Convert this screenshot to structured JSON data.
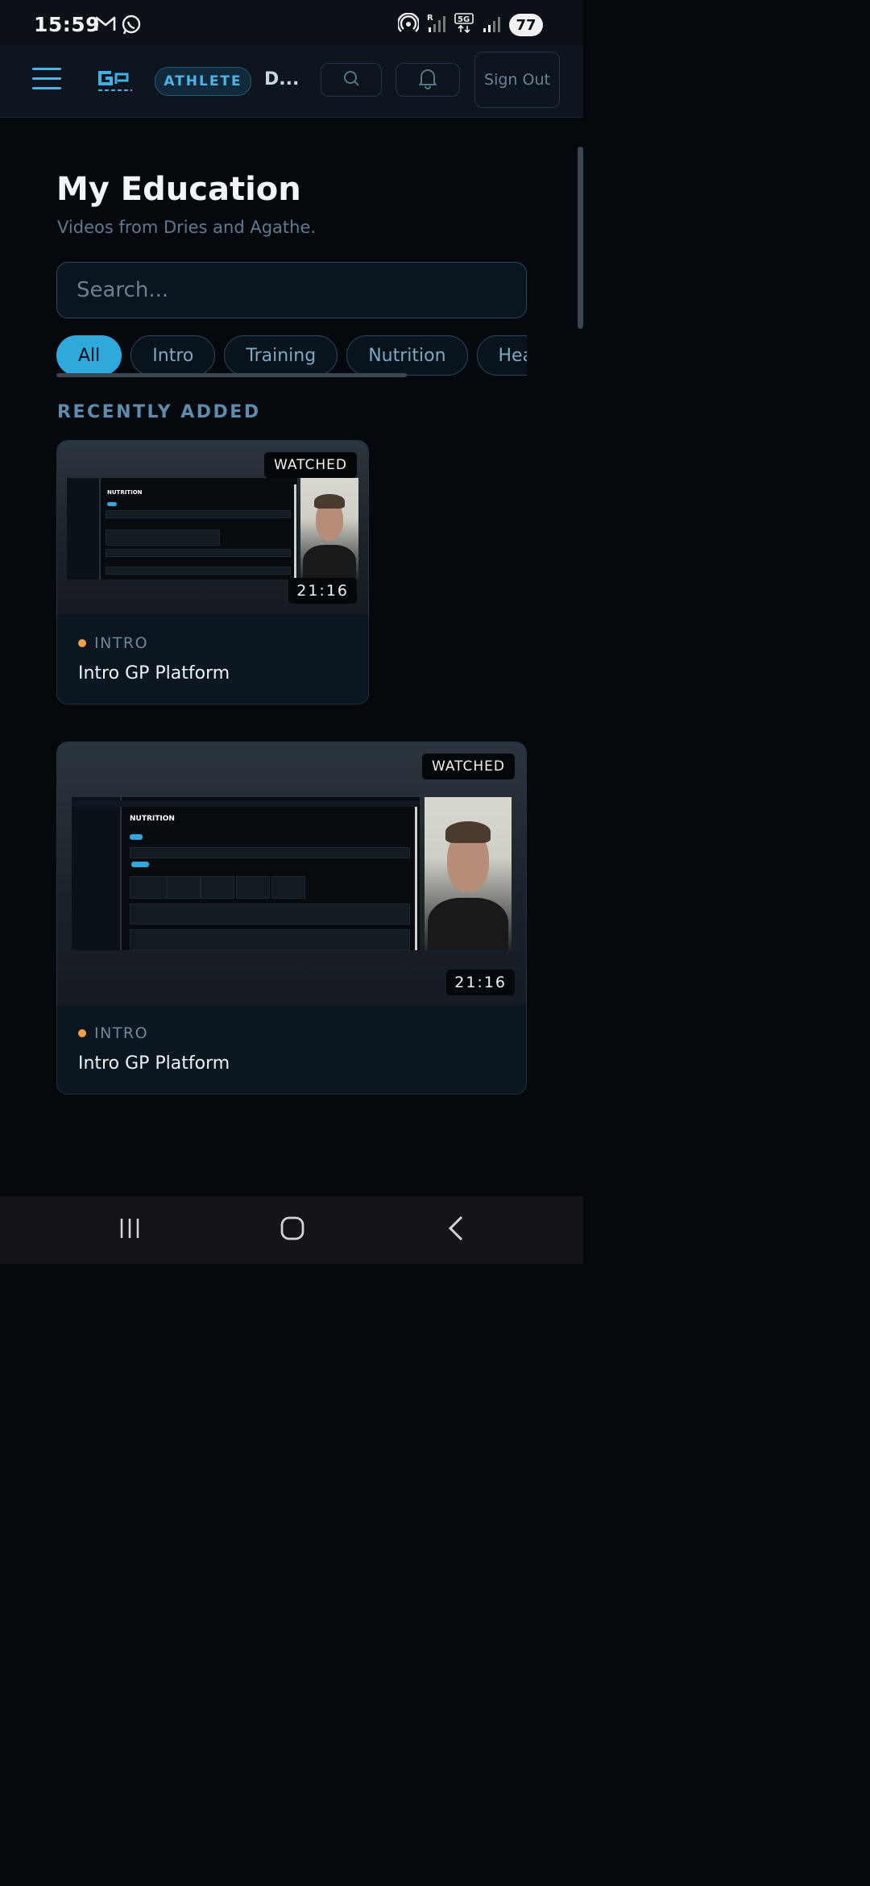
{
  "status_bar": {
    "time": "15:59",
    "battery": "77",
    "left_icons": [
      "gmail-icon",
      "whatsapp-icon"
    ],
    "right_icons": [
      "hotspot-icon",
      "signal-roaming-icon",
      "5g-icon",
      "signal-icon"
    ]
  },
  "header": {
    "role_badge": "ATHLETE",
    "user_short": "D...",
    "sign_out_label": "Sign Out"
  },
  "page": {
    "title": "My Education",
    "subtitle": "Videos from Dries and Agathe."
  },
  "search": {
    "placeholder": "Search...",
    "value": ""
  },
  "filters": {
    "active": "All",
    "items": [
      "All",
      "Intro",
      "Training",
      "Nutrition",
      "Health"
    ]
  },
  "sections": {
    "recent_label": "RECENTLY ADDED"
  },
  "videos": [
    {
      "status": "WATCHED",
      "duration": "21:16",
      "category": "INTRO",
      "title": "Intro GP Platform",
      "thumb_heading": "NUTRITION"
    },
    {
      "status": "WATCHED",
      "duration": "21:16",
      "category": "INTRO",
      "title": "Intro GP Platform",
      "thumb_heading": "NUTRITION"
    }
  ],
  "colors": {
    "accent": "#2fa8dc",
    "category_dot": "#f0a14b",
    "background": "#05090d"
  }
}
